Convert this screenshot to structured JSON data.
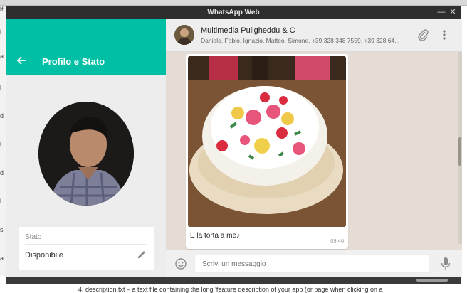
{
  "window": {
    "title": "WhatsApp Web",
    "minimize_glyph": "—",
    "close_glyph": "✕"
  },
  "background_page": {
    "left_fragments": [
      "lfi",
      "l",
      "a",
      "l",
      "d",
      "l",
      "d",
      "l",
      "s",
      "a"
    ],
    "bottom_text": "4. description.txt – a text file containing the long 'feature description of your app (or page when clicking on a"
  },
  "profile_panel": {
    "back_icon": "arrow-left-icon",
    "title": "Profilo e Stato",
    "status_label": "Stato",
    "status_value": "Disponibile",
    "edit_icon": "pencil-icon"
  },
  "chat": {
    "name": "Multimedia Puligheddu & C",
    "members": "Daniele, Fabio, Ignazio, Matteo, Simone, +39 328 348 7559, +39 328 64...",
    "attach_icon": "paperclip-icon",
    "menu_icon": "more-vertical-icon",
    "message": {
      "caption": "E la torta a me",
      "emoji": "♪",
      "time": "09:46",
      "image": "photo-of-cake-with-flowers"
    },
    "composer": {
      "emoji_icon": "smiley-icon",
      "placeholder": "Scrivi un messaggio",
      "mic_icon": "microphone-icon"
    }
  },
  "colors": {
    "accent": "#00bfa5",
    "chat_background": "#e5ddd5",
    "panel_background": "#ededed"
  }
}
